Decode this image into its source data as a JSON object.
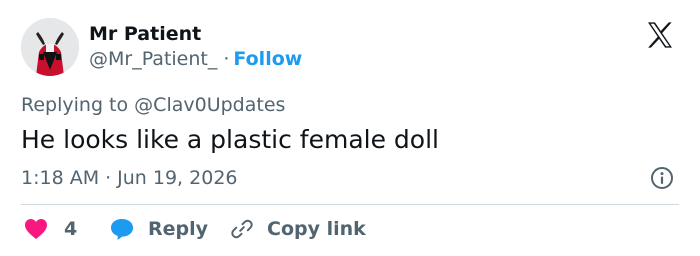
{
  "user": {
    "name": "Mr Patient",
    "handle": "@Mr_Patient_",
    "separator": "·",
    "follow_label": "Follow"
  },
  "tweet": {
    "replying_prefix": "Replying to",
    "replying_to": "@Clav0Updates",
    "text": "He looks like a plastic female doll",
    "time": "1:18 AM",
    "time_separator": "·",
    "date": "Jun 19, 2026"
  },
  "actions": {
    "like_count": "4",
    "reply_label": "Reply",
    "copy_label": "Copy link"
  },
  "icons": {
    "platform": "x-logo-icon",
    "info": "info-icon",
    "like": "heart-icon",
    "reply": "speech-bubble-icon",
    "copy": "link-icon"
  },
  "colors": {
    "text": "#0f1419",
    "secondary": "#536471",
    "accent": "#1d9bf0",
    "like": "#f91880",
    "divider": "#cfd9de"
  }
}
